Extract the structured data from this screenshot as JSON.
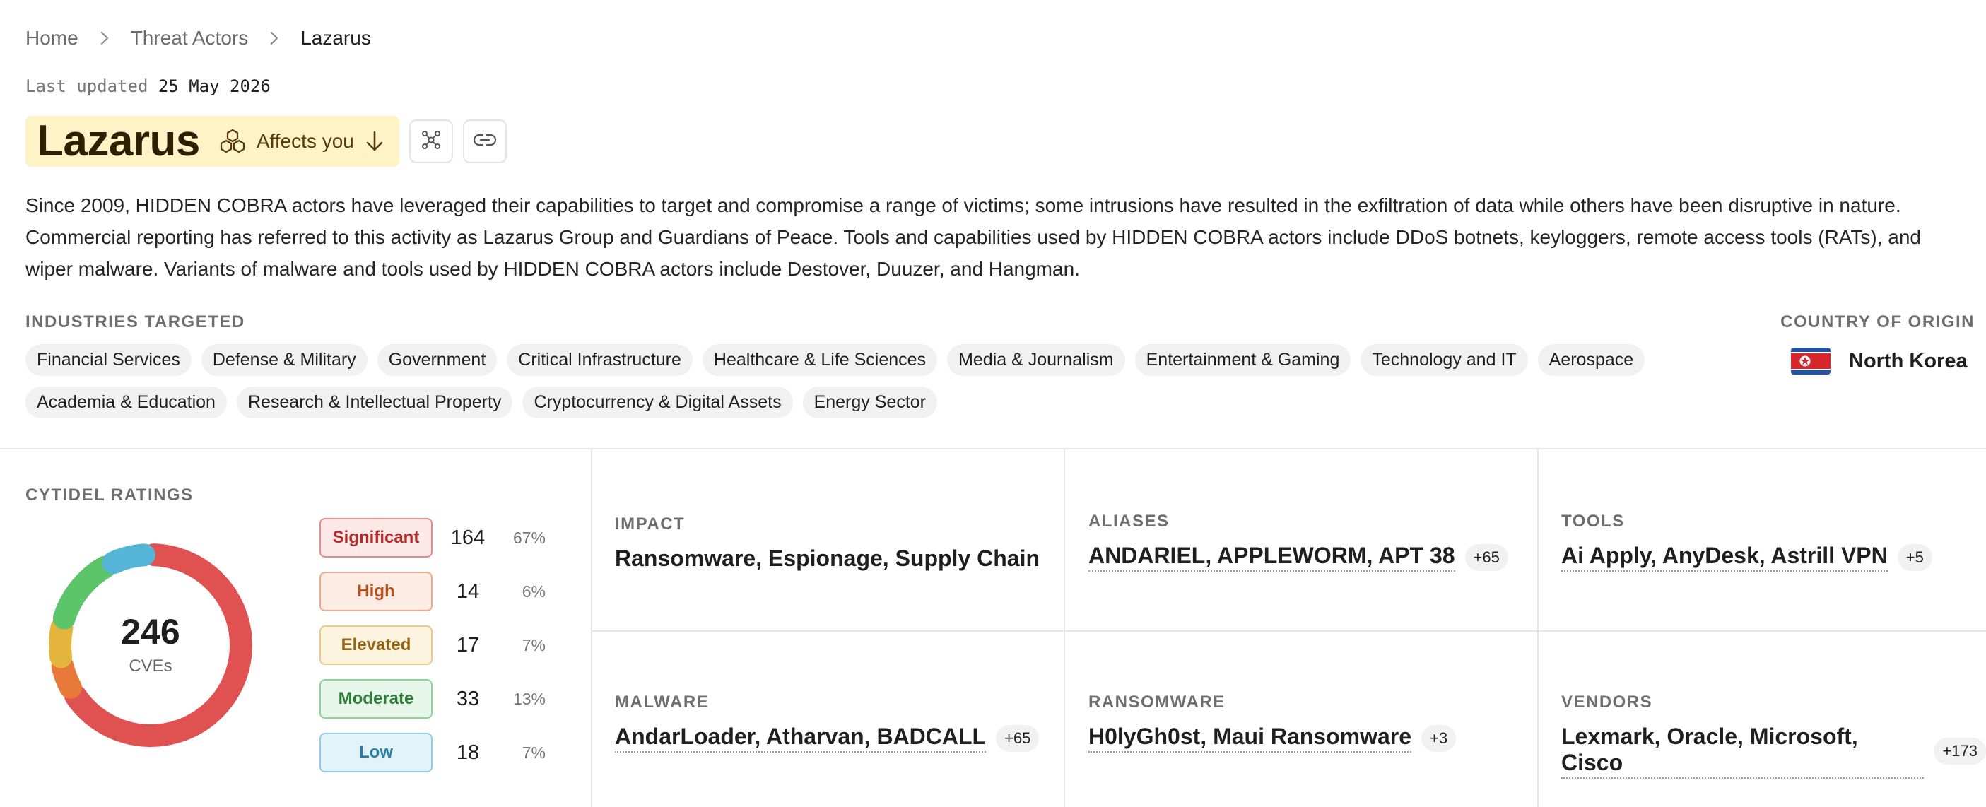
{
  "breadcrumb": {
    "home": "Home",
    "section": "Threat Actors",
    "current": "Lazarus"
  },
  "updated": {
    "label": "Last updated",
    "date": "25 May 2026"
  },
  "actor": {
    "name": "Lazarus",
    "affects_label": "Affects you"
  },
  "description": "Since 2009, HIDDEN COBRA actors have leveraged their capabilities to target and compromise a range of victims; some intrusions have resulted in the exfiltration of data while others have been disruptive in nature. Commercial reporting has referred to this activity as Lazarus Group and Guardians of Peace. Tools and capabilities used by HIDDEN COBRA actors include DDoS botnets, keyloggers, remote access tools (RATs), and wiper malware. Variants of malware and tools used by HIDDEN COBRA actors include Destover, Duuzer, and Hangman.",
  "industries": {
    "label": "INDUSTRIES TARGETED",
    "items": [
      "Financial Services",
      "Defense & Military",
      "Government",
      "Critical Infrastructure",
      "Healthcare & Life Sciences",
      "Media & Journalism",
      "Entertainment & Gaming",
      "Technology and IT",
      "Aerospace",
      "Academia & Education",
      "Research & Intellectual Property",
      "Cryptocurrency & Digital Assets",
      "Energy Sector"
    ]
  },
  "country": {
    "label": "COUNTRY OF ORIGIN",
    "name": "North Korea"
  },
  "ratings": {
    "label": "CYTIDEL RATINGS",
    "total": "246",
    "unit": "CVEs",
    "levels": [
      {
        "name": "Significant",
        "count": "164",
        "pct": "67%",
        "value": 164,
        "color": "#e05252",
        "bg": "#fde8e8",
        "border": "#e88a8a",
        "text": "#b42a2a"
      },
      {
        "name": "High",
        "count": "14",
        "pct": "6%",
        "value": 14,
        "color": "#e8793a",
        "bg": "#fdece3",
        "border": "#eea98a",
        "text": "#b8501c"
      },
      {
        "name": "Elevated",
        "count": "17",
        "pct": "7%",
        "value": 17,
        "color": "#e3b53c",
        "bg": "#fdf4e0",
        "border": "#ecc98a",
        "text": "#946511"
      },
      {
        "name": "Moderate",
        "count": "33",
        "pct": "13%",
        "value": 33,
        "color": "#5cc469",
        "bg": "#e6f6e8",
        "border": "#8ed39a",
        "text": "#2e7d3a"
      },
      {
        "name": "Low",
        "count": "18",
        "pct": "7%",
        "value": 18,
        "color": "#55b5d6",
        "bg": "#e3f3fa",
        "border": "#8ecde6",
        "text": "#2a7ea3"
      }
    ]
  },
  "cells": {
    "impact": {
      "label": "IMPACT",
      "value": "Ransomware, Espionage, Supply Chain"
    },
    "aliases": {
      "label": "ALIASES",
      "value": "ANDARIEL, APPLEWORM, APT 38",
      "more": "+65"
    },
    "tools": {
      "label": "TOOLS",
      "value": "Ai Apply, AnyDesk, Astrill VPN",
      "more": "+5"
    },
    "malware": {
      "label": "MALWARE",
      "value": "AndarLoader, Atharvan, BADCALL",
      "more": "+65"
    },
    "ransomware": {
      "label": "RANSOMWARE",
      "value": "H0lyGh0st, Maui Ransomware",
      "more": "+3"
    },
    "vendors": {
      "label": "VENDORS",
      "value": "Lexmark, Oracle, Microsoft, Cisco",
      "more": "+173"
    }
  },
  "colors": {
    "title_bg": "#fdf3c7",
    "divider": "#e6e6e6",
    "chip_bg": "#f1f1f1"
  },
  "icons": [
    "chevron-right-icon",
    "hexagon-cluster-icon",
    "arrow-down-icon",
    "graph-nodes-icon",
    "link-icon",
    "north-korea-flag-icon"
  ]
}
